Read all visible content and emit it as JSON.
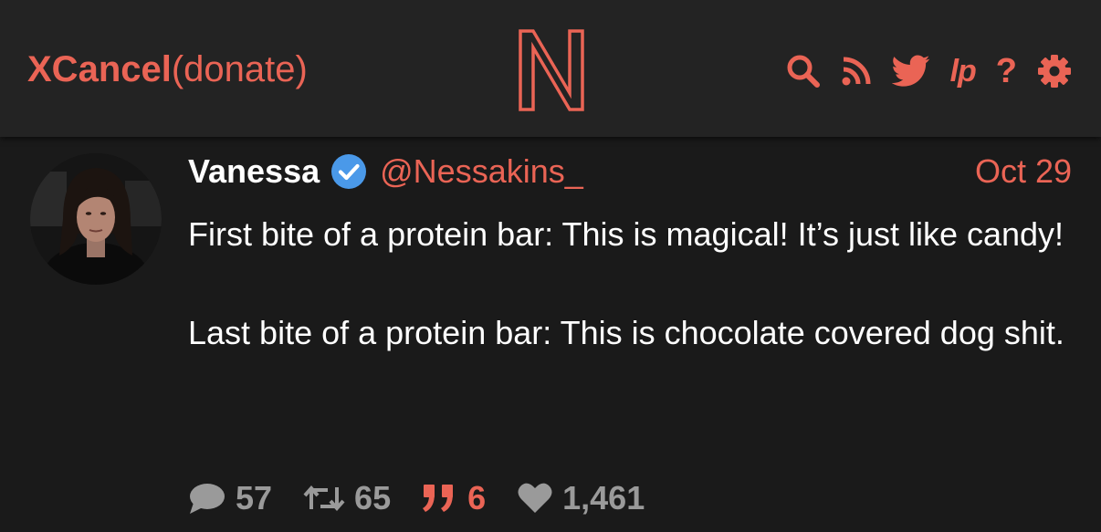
{
  "header": {
    "brand_name": "XCancel",
    "donate_label": "(donate)",
    "logo_letter": "N",
    "nav": [
      {
        "icon": "search-icon"
      },
      {
        "icon": "rss-icon"
      },
      {
        "icon": "twitter-bird-icon"
      },
      {
        "icon": "liberapay-icon",
        "label": "lp"
      },
      {
        "icon": "help-icon",
        "label": "?"
      },
      {
        "icon": "gear-icon"
      }
    ]
  },
  "tweet": {
    "fullname": "Vanessa",
    "verified": true,
    "username": "@Nessakins_",
    "date": "Oct 29",
    "paragraphs": [
      "First bite of a protein bar: This is magical! It’s just like candy!",
      "Last bite of a protein bar: This is chocolate covered dog shit."
    ],
    "stats": {
      "replies": "57",
      "retweets": "65",
      "quotes": "6",
      "likes": "1,461"
    }
  },
  "colors": {
    "accent": "#ea6455",
    "background": "#1a1a1a",
    "header_background": "#232323",
    "text": "#ffffff",
    "muted": "#9a9a9a",
    "verified_blue": "#4a99e9"
  }
}
